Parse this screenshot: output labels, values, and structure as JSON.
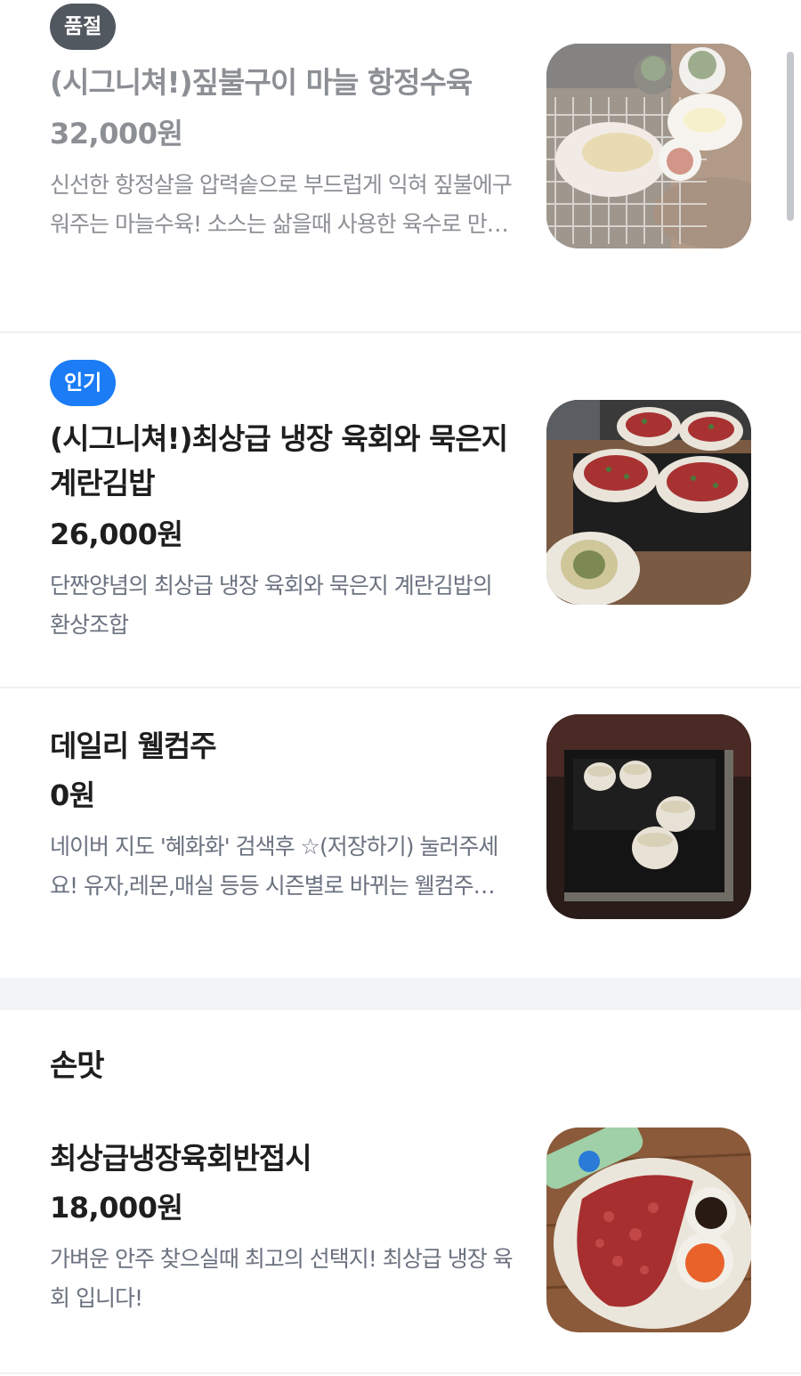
{
  "items": [
    {
      "badge": "품절",
      "name": "(시그니쳐!)짚불구이 마늘 항정수육",
      "price": "32,000원",
      "description": "신선한  항정살을 압력솥으로 부드럽게 익혀 짚불에구워주는 마늘수육! 소스는 삶을때 사용한 육수로 만들었습니다",
      "sold_out": true,
      "photo": "garlic-pork-photo"
    },
    {
      "badge": "인기",
      "name": "(시그니쳐!)최상급 냉장 육회와 묵은지 계란김밥",
      "price": "26,000원",
      "description": "단짠양념의 최상급 냉장 육회와 묵은지 계란김밥의 환상조합",
      "sold_out": false,
      "photo": "yukhoe-kimbap-photo"
    },
    {
      "name": "데일리 웰컴주",
      "price": "0원",
      "description": "네이버 지도 '혜화화' 검색후 ☆(저장하기) 눌러주세요! 유자,레몬,매실 등등 시즌별로 바뀌는 웰컴주를 드립니다",
      "sold_out": false,
      "photo": "welcome-drink-photo"
    }
  ],
  "section": {
    "title": "손맛",
    "items": [
      {
        "name": "최상급냉장육회반접시",
        "price": "18,000원",
        "description": "가벼운 안주 찾으실때 최고의 선택지! 최상급 냉장 육회 입니다!",
        "photo": "half-yukhoe-photo"
      }
    ]
  },
  "colors": {
    "badge_soldout": "#515860",
    "badge_popular": "#1b7cf6",
    "description_text": "#6b7280",
    "section_gap": "#f2f4f6"
  }
}
